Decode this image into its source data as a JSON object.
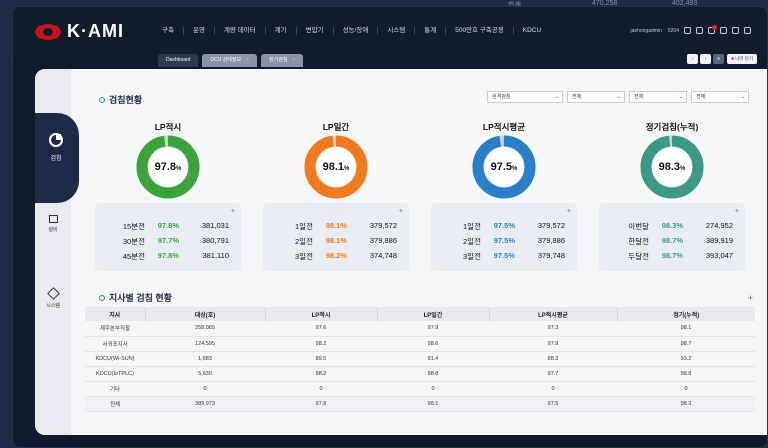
{
  "bg": {
    "t1": "합계",
    "t2": "470,258",
    "t3": "402,493"
  },
  "header": {
    "logo": "K·AMI",
    "menu": [
      "구축",
      "운영",
      "계량 데이터",
      "계기",
      "변압기",
      "성능/장애",
      "시스템",
      "통계",
      "500만호 구축공정",
      "KDCU"
    ],
    "user": "jaehongadmin",
    "code": "5204"
  },
  "tabs": [
    {
      "label": "Dashboard"
    },
    {
      "label": "DCU 상태정보"
    },
    {
      "label": "정기검침"
    }
  ],
  "tab_all_close": "나머 닫기",
  "sidebar": {
    "active": "검침",
    "items": [
      "설비",
      "시스템"
    ]
  },
  "section1": {
    "title": "검침현황"
  },
  "filters": [
    "원격검침",
    "전체",
    "전체",
    "전체"
  ],
  "cards": [
    {
      "title": "LP적시",
      "center": "97.8",
      "unit": "%",
      "color": "#3aa43a",
      "rows": [
        {
          "label": "15분전",
          "pct": "97.8%",
          "val": "381,031"
        },
        {
          "label": "30분전",
          "pct": "97.7%",
          "val": "380,791"
        },
        {
          "label": "45분전",
          "pct": "97.8%",
          "val": "381,110"
        }
      ]
    },
    {
      "title": "LP일간",
      "center": "98.1",
      "unit": "%",
      "color": "#f07a1e",
      "rows": [
        {
          "label": "1일전",
          "pct": "98.1%",
          "val": "379,572"
        },
        {
          "label": "2일전",
          "pct": "98.1%",
          "val": "379,886"
        },
        {
          "label": "3일전",
          "pct": "98.2%",
          "val": "374,748"
        }
      ]
    },
    {
      "title": "LP적시평균",
      "center": "97.5",
      "unit": "%",
      "color": "#2a7fc8",
      "rows": [
        {
          "label": "1일전",
          "pct": "97.5%",
          "val": "379,572"
        },
        {
          "label": "2일전",
          "pct": "97.5%",
          "val": "379,886"
        },
        {
          "label": "3일전",
          "pct": "97.5%",
          "val": "379,748"
        }
      ]
    },
    {
      "title": "정기검침(누적)",
      "center": "98.3",
      "unit": "%",
      "color": "#3a9a86",
      "rows": [
        {
          "label": "이번달",
          "pct": "98.3%",
          "val": "274,952"
        },
        {
          "label": "한달전",
          "pct": "98.7%",
          "val": "389,919"
        },
        {
          "label": "두달전",
          "pct": "98.7%",
          "val": "393,047"
        }
      ]
    }
  ],
  "section2": {
    "title": "지사별 검침 현황"
  },
  "table": {
    "headers": [
      "지사",
      "대상(호)",
      "LP적시",
      "LP일간",
      "LP적시평균",
      "정기(누적)"
    ],
    "rows": [
      [
        "제주본부직할",
        "258,065",
        "97.6",
        "97.9",
        "97.3",
        "98.1"
      ],
      [
        "서귀포지사",
        "124,595",
        "98.2",
        "98.6",
        "97.9",
        "98.7"
      ],
      [
        "KDCU(Wi-SUN)",
        "1,683",
        "89.5",
        "91.4",
        "88.3",
        "93.2"
      ],
      [
        "KDCU(IoTPLC)",
        "5,630",
        "98.2",
        "98.8",
        "97.7",
        "98.8"
      ],
      [
        "기타",
        "0",
        "0",
        "0",
        "0",
        "0"
      ],
      [
        "전체",
        "389,973",
        "97.8",
        "98.1",
        "97.5",
        "98.3"
      ]
    ]
  }
}
